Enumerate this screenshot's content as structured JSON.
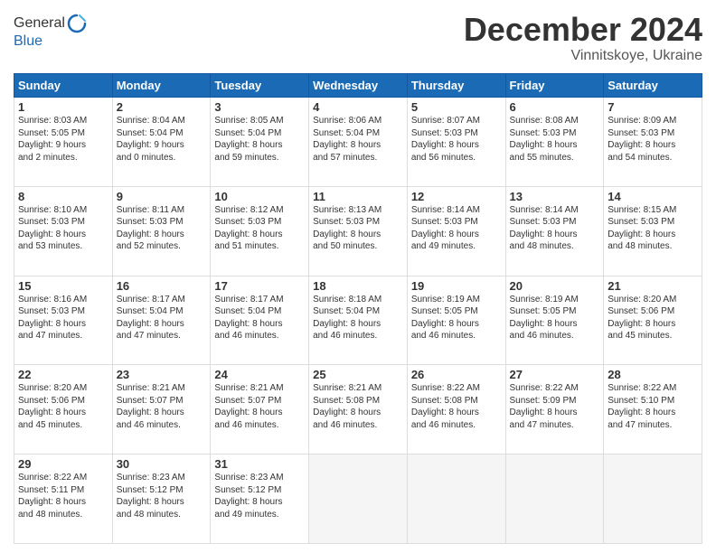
{
  "header": {
    "logo_line1": "General",
    "logo_line2": "Blue",
    "month": "December 2024",
    "location": "Vinnitskoye, Ukraine"
  },
  "weekdays": [
    "Sunday",
    "Monday",
    "Tuesday",
    "Wednesday",
    "Thursday",
    "Friday",
    "Saturday"
  ],
  "weeks": [
    [
      {
        "day": "1",
        "info": "Sunrise: 8:03 AM\nSunset: 5:05 PM\nDaylight: 9 hours\nand 2 minutes."
      },
      {
        "day": "2",
        "info": "Sunrise: 8:04 AM\nSunset: 5:04 PM\nDaylight: 9 hours\nand 0 minutes."
      },
      {
        "day": "3",
        "info": "Sunrise: 8:05 AM\nSunset: 5:04 PM\nDaylight: 8 hours\nand 59 minutes."
      },
      {
        "day": "4",
        "info": "Sunrise: 8:06 AM\nSunset: 5:04 PM\nDaylight: 8 hours\nand 57 minutes."
      },
      {
        "day": "5",
        "info": "Sunrise: 8:07 AM\nSunset: 5:03 PM\nDaylight: 8 hours\nand 56 minutes."
      },
      {
        "day": "6",
        "info": "Sunrise: 8:08 AM\nSunset: 5:03 PM\nDaylight: 8 hours\nand 55 minutes."
      },
      {
        "day": "7",
        "info": "Sunrise: 8:09 AM\nSunset: 5:03 PM\nDaylight: 8 hours\nand 54 minutes."
      }
    ],
    [
      {
        "day": "8",
        "info": "Sunrise: 8:10 AM\nSunset: 5:03 PM\nDaylight: 8 hours\nand 53 minutes."
      },
      {
        "day": "9",
        "info": "Sunrise: 8:11 AM\nSunset: 5:03 PM\nDaylight: 8 hours\nand 52 minutes."
      },
      {
        "day": "10",
        "info": "Sunrise: 8:12 AM\nSunset: 5:03 PM\nDaylight: 8 hours\nand 51 minutes."
      },
      {
        "day": "11",
        "info": "Sunrise: 8:13 AM\nSunset: 5:03 PM\nDaylight: 8 hours\nand 50 minutes."
      },
      {
        "day": "12",
        "info": "Sunrise: 8:14 AM\nSunset: 5:03 PM\nDaylight: 8 hours\nand 49 minutes."
      },
      {
        "day": "13",
        "info": "Sunrise: 8:14 AM\nSunset: 5:03 PM\nDaylight: 8 hours\nand 48 minutes."
      },
      {
        "day": "14",
        "info": "Sunrise: 8:15 AM\nSunset: 5:03 PM\nDaylight: 8 hours\nand 48 minutes."
      }
    ],
    [
      {
        "day": "15",
        "info": "Sunrise: 8:16 AM\nSunset: 5:03 PM\nDaylight: 8 hours\nand 47 minutes."
      },
      {
        "day": "16",
        "info": "Sunrise: 8:17 AM\nSunset: 5:04 PM\nDaylight: 8 hours\nand 47 minutes."
      },
      {
        "day": "17",
        "info": "Sunrise: 8:17 AM\nSunset: 5:04 PM\nDaylight: 8 hours\nand 46 minutes."
      },
      {
        "day": "18",
        "info": "Sunrise: 8:18 AM\nSunset: 5:04 PM\nDaylight: 8 hours\nand 46 minutes."
      },
      {
        "day": "19",
        "info": "Sunrise: 8:19 AM\nSunset: 5:05 PM\nDaylight: 8 hours\nand 46 minutes."
      },
      {
        "day": "20",
        "info": "Sunrise: 8:19 AM\nSunset: 5:05 PM\nDaylight: 8 hours\nand 46 minutes."
      },
      {
        "day": "21",
        "info": "Sunrise: 8:20 AM\nSunset: 5:06 PM\nDaylight: 8 hours\nand 45 minutes."
      }
    ],
    [
      {
        "day": "22",
        "info": "Sunrise: 8:20 AM\nSunset: 5:06 PM\nDaylight: 8 hours\nand 45 minutes."
      },
      {
        "day": "23",
        "info": "Sunrise: 8:21 AM\nSunset: 5:07 PM\nDaylight: 8 hours\nand 46 minutes."
      },
      {
        "day": "24",
        "info": "Sunrise: 8:21 AM\nSunset: 5:07 PM\nDaylight: 8 hours\nand 46 minutes."
      },
      {
        "day": "25",
        "info": "Sunrise: 8:21 AM\nSunset: 5:08 PM\nDaylight: 8 hours\nand 46 minutes."
      },
      {
        "day": "26",
        "info": "Sunrise: 8:22 AM\nSunset: 5:08 PM\nDaylight: 8 hours\nand 46 minutes."
      },
      {
        "day": "27",
        "info": "Sunrise: 8:22 AM\nSunset: 5:09 PM\nDaylight: 8 hours\nand 47 minutes."
      },
      {
        "day": "28",
        "info": "Sunrise: 8:22 AM\nSunset: 5:10 PM\nDaylight: 8 hours\nand 47 minutes."
      }
    ],
    [
      {
        "day": "29",
        "info": "Sunrise: 8:22 AM\nSunset: 5:11 PM\nDaylight: 8 hours\nand 48 minutes."
      },
      {
        "day": "30",
        "info": "Sunrise: 8:23 AM\nSunset: 5:12 PM\nDaylight: 8 hours\nand 48 minutes."
      },
      {
        "day": "31",
        "info": "Sunrise: 8:23 AM\nSunset: 5:12 PM\nDaylight: 8 hours\nand 49 minutes."
      },
      {
        "day": "",
        "info": ""
      },
      {
        "day": "",
        "info": ""
      },
      {
        "day": "",
        "info": ""
      },
      {
        "day": "",
        "info": ""
      }
    ]
  ]
}
